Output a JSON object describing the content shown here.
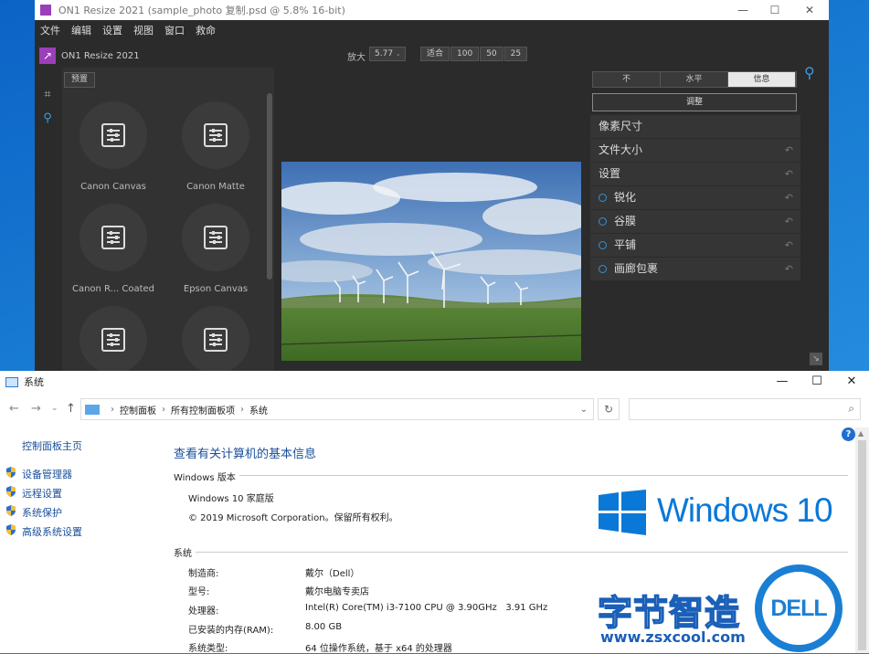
{
  "on1": {
    "window_title": "ON1 Resize 2021 (sample_photo 复制.psd @ 5.8% 16-bit)",
    "controls": {
      "minimize": "—",
      "maximize": "☐",
      "close": "✕"
    },
    "menu": [
      "文件",
      "编辑",
      "设置",
      "视图",
      "窗口",
      "救命"
    ],
    "app_name": "ON1 Resize 2021",
    "zoom_label": "放大",
    "zoom_value": "5.77",
    "zoom_buttons": [
      "适合",
      "100",
      "50",
      "25"
    ],
    "presets_button": "预置",
    "presets": [
      "Canon Canvas",
      "Canon Matte",
      "Canon R... Coated",
      "Epson Canvas",
      "",
      ""
    ],
    "segments": [
      "不",
      "水平",
      "信息"
    ],
    "adjust_button": "调整",
    "rows": [
      {
        "label": "像素尺寸",
        "dot": false,
        "undo": false
      },
      {
        "label": "文件大小",
        "dot": false,
        "undo": true
      },
      {
        "label": "设置",
        "dot": false,
        "undo": true
      },
      {
        "label": "锐化",
        "dot": true,
        "undo": true
      },
      {
        "label": "谷膜",
        "dot": true,
        "undo": true
      },
      {
        "label": "平铺",
        "dot": true,
        "undo": true
      },
      {
        "label": "画廊包裹",
        "dot": true,
        "undo": true
      }
    ],
    "accent": "#9b3fb8"
  },
  "sys": {
    "window_title": "系统",
    "controls": {
      "minimize": "—",
      "maximize": "☐",
      "close": "✕"
    },
    "nav": {
      "back": "←",
      "forward": "→",
      "down": "⌄",
      "up": "↑"
    },
    "breadcrumb": [
      "控制面板",
      "所有控制面板项",
      "系统"
    ],
    "sidebar_home": "控制面板主页",
    "sidebar_links": [
      "设备管理器",
      "远程设置",
      "系统保护",
      "高级系统设置"
    ],
    "heading": "查看有关计算机的基本信息",
    "edition_section": "Windows 版本",
    "edition": "Windows 10 家庭版",
    "copyright": "© 2019 Microsoft Corporation。保留所有权利。",
    "logo_text": "Windows 10",
    "system_section": "系统",
    "specs": [
      {
        "label": "制造商:",
        "value": "戴尔（Dell）"
      },
      {
        "label": "型号:",
        "value": "戴尔电脑专卖店"
      },
      {
        "label": "处理器:",
        "value": "Intel(R) Core(TM) i3-7100 CPU @ 3.90GHz   3.91 GHz"
      },
      {
        "label": "已安装的内存(RAM):",
        "value": "8.00 GB"
      },
      {
        "label": "系统类型:",
        "value": "64 位操作系统，基于 x64 的处理器"
      }
    ],
    "help": "?",
    "accent": "#1a4f9a"
  },
  "watermark": {
    "cn": "字节智造",
    "url": "www.zsxcool.com",
    "dell": "DELL"
  }
}
